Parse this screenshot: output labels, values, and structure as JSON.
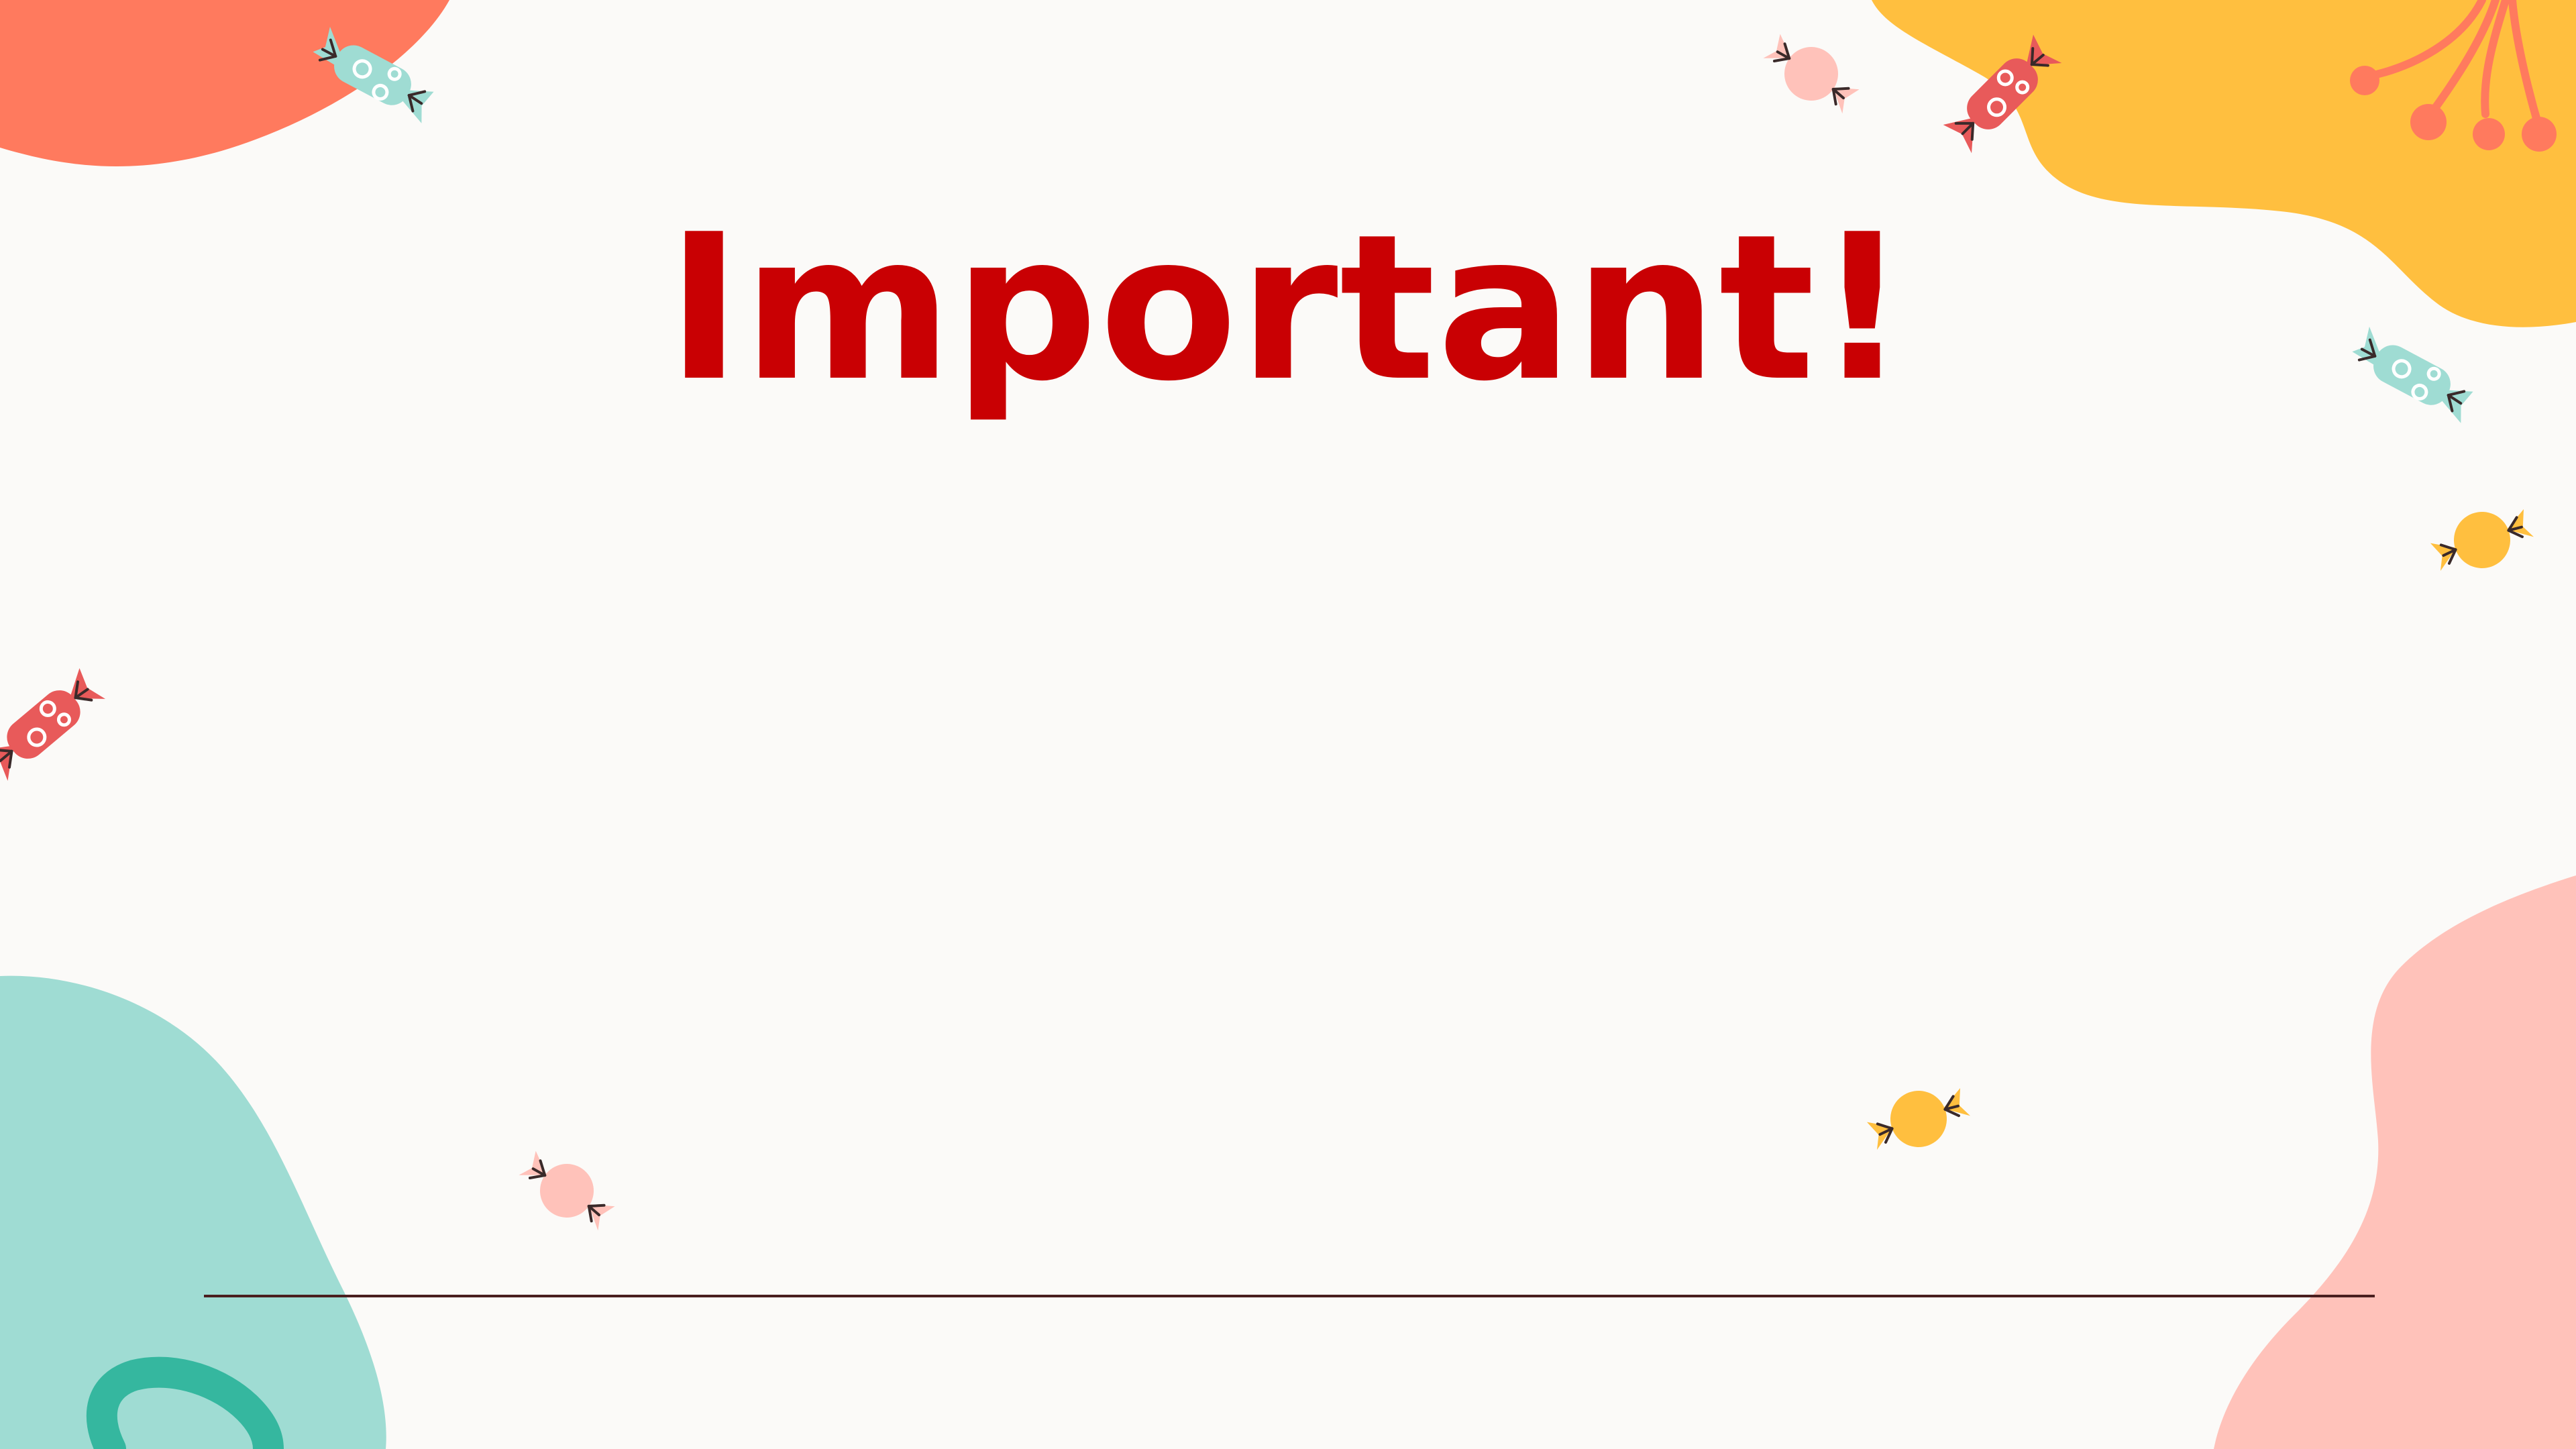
{
  "slide": {
    "title": "Important!"
  },
  "colors": {
    "background": "#fbfaf8",
    "title": "#c90003",
    "blob_coral": "#ff7a5e",
    "blob_yellow": "#ffbf3f",
    "blob_teal": "#9fdcd3",
    "blob_pink": "#ffc2ba",
    "divider": "#4a1f1f"
  },
  "icons": [
    "candy-teal-icon",
    "candy-pink-icon",
    "candy-red-icon",
    "candy-yellow-icon",
    "flower-stems-icon",
    "teal-ring-icon"
  ]
}
